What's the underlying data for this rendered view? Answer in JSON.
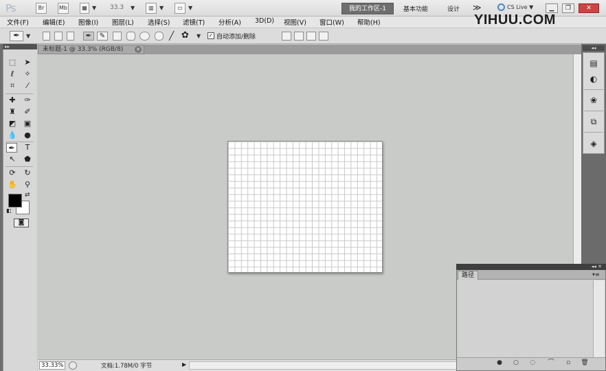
{
  "app": {
    "logo_text": "Ps"
  },
  "titlebar": {
    "zoom_value": "33.3",
    "workspace_active": "我的工作区-1",
    "workspace_basic": "基本功能",
    "workspace_design": "设计",
    "more": "≫",
    "cslive": "CS Live"
  },
  "menu": {
    "items": [
      "文件(F)",
      "编辑(E)",
      "图像(I)",
      "图层(L)",
      "选择(S)",
      "滤镜(T)",
      "分析(A)",
      "3D(D)",
      "视图(V)",
      "窗口(W)",
      "帮助(H)"
    ]
  },
  "watermark": {
    "brand": "YIHUU.COM"
  },
  "options": {
    "auto_add_delete_label": "自动添加/删除",
    "auto_add_delete_checked": true
  },
  "document": {
    "tab_title": "未标题-1 @ 33.3% (RGB/8)",
    "zoom": "33.33%",
    "info": "文档:1.78M/0 字节"
  },
  "colors": {
    "foreground": "#000000",
    "background": "#ffffff"
  },
  "panels": {
    "paths_tab": "路径"
  },
  "icons": {
    "tools": [
      "marquee-icon",
      "move-icon",
      "lasso-icon",
      "quick-select-icon",
      "crop-icon",
      "eyedropper-icon",
      "spot-heal-icon",
      "brush-icon",
      "clone-stamp-icon",
      "history-brush-icon",
      "eraser-icon",
      "gradient-icon",
      "blur-icon",
      "dodge-icon",
      "pen-icon",
      "type-icon",
      "path-select-icon",
      "shape-icon",
      "3d-rotate-icon",
      "3d-orbit-icon",
      "hand-icon",
      "zoom-icon"
    ],
    "dock": [
      "histogram-icon",
      "color-icon",
      "styles-icon",
      "adjustments-icon",
      "layers-icon"
    ],
    "paths_footer": [
      "fill-path-icon",
      "stroke-path-icon",
      "load-selection-icon",
      "make-path-icon",
      "new-path-icon",
      "delete-path-icon"
    ]
  }
}
